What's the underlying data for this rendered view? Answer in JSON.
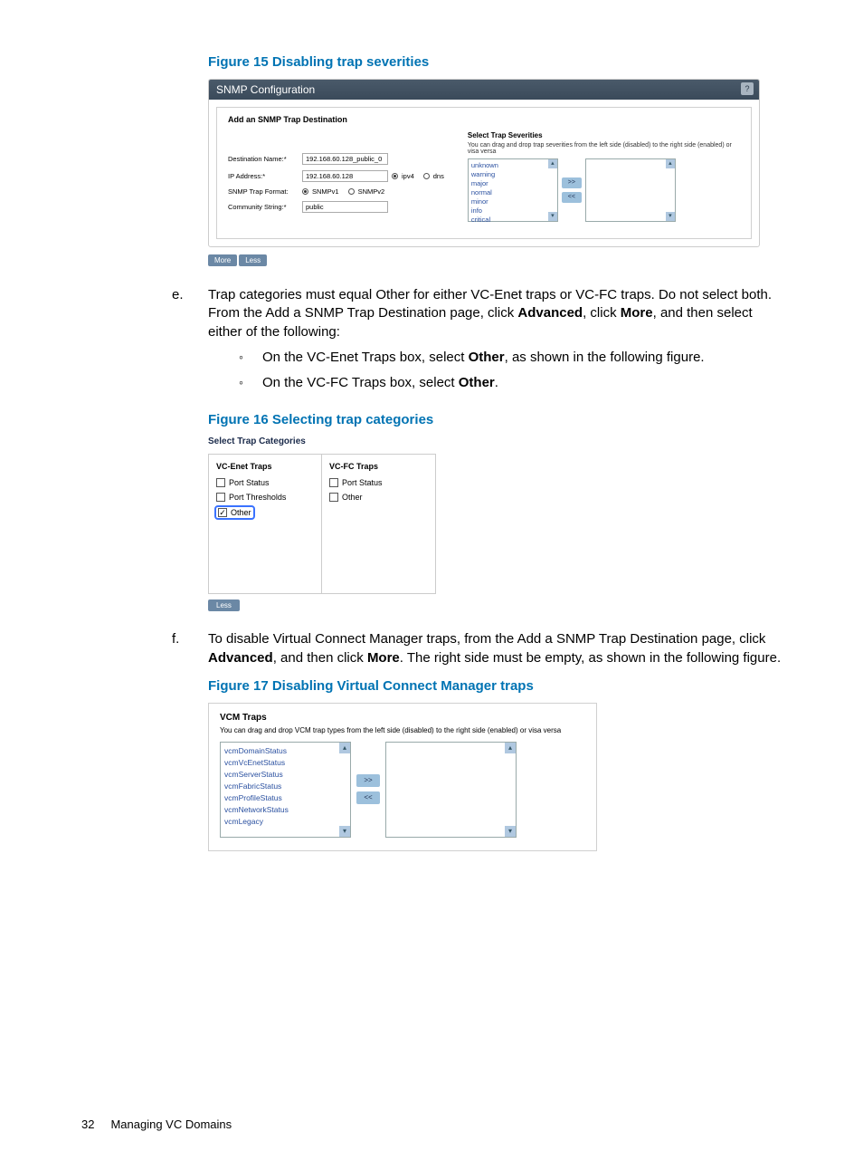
{
  "figure15": {
    "caption": "Figure 15 Disabling trap severities",
    "window_title": "SNMP Configuration",
    "panel_title": "Add an SNMP Trap Destination",
    "fields": {
      "dest_name_label": "Destination Name:*",
      "dest_name_value": "192.168.60.128_public_0",
      "ip_label": "IP Address:*",
      "ip_value": "192.168.60.128",
      "ipv4_label": "ipv4",
      "dns_label": "dns",
      "format_label": "SNMP Trap Format:",
      "format_v1": "SNMPv1",
      "format_v2": "SNMPv2",
      "community_label": "Community String:*",
      "community_value": "public"
    },
    "severities": {
      "title": "Select Trap Severities",
      "note": "You can drag and drop trap severities from the left side (disabled) to the right side (enabled) or visa versa",
      "items": [
        "unknown",
        "warning",
        "major",
        "normal",
        "minor",
        "info",
        "critical"
      ]
    },
    "more": "More",
    "less": "Less"
  },
  "step_e": {
    "marker": "e.",
    "text_1": "Trap categories must equal Other for either VC-Enet traps or VC-FC traps. Do not select both. From the Add a SNMP Trap Destination page, click ",
    "bold_1": "Advanced",
    "text_2": ", click ",
    "bold_2": "More",
    "text_3": ", and then select either of the following:",
    "bullet_1a": "On the VC-Enet Traps box, select ",
    "bullet_1b": "Other",
    "bullet_1c": ", as shown in the following figure.",
    "bullet_2a": "On the VC-FC Traps box, select ",
    "bullet_2b": "Other",
    "bullet_2c": "."
  },
  "figure16": {
    "caption": "Figure 16 Selecting trap categories",
    "title": "Select Trap Categories",
    "col1_head": "VC-Enet Traps",
    "col1_items": [
      "Port Status",
      "Port Thresholds",
      "Other"
    ],
    "col2_head": "VC-FC Traps",
    "col2_items": [
      "Port Status",
      "Other"
    ],
    "less": "Less"
  },
  "step_f": {
    "marker": "f.",
    "text_1": "To disable Virtual Connect Manager traps, from the Add a SNMP Trap Destination page, click ",
    "bold_1": "Advanced",
    "text_2": ", and then click ",
    "bold_2": "More",
    "text_3": ". The right side must be empty, as shown in the following figure."
  },
  "figure17": {
    "caption": "Figure 17 Disabling Virtual Connect Manager traps",
    "title": "VCM Traps",
    "note": "You can drag and drop VCM trap types from the left side (disabled) to the right side (enabled) or visa versa",
    "items": [
      "vcmDomainStatus",
      "vcmVcEnetStatus",
      "vcmServerStatus",
      "vcmFabricStatus",
      "vcmProfileStatus",
      "vcmNetworkStatus",
      "vcmLegacy"
    ]
  },
  "footer": {
    "page": "32",
    "section": "Managing VC Domains"
  },
  "glyph": {
    "up": "▴",
    "down": "▾",
    "right": ">>",
    "left": "<<"
  }
}
